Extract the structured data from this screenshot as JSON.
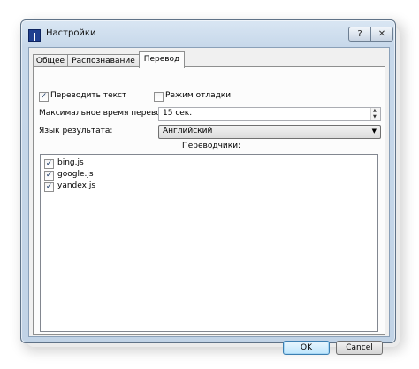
{
  "window": {
    "title": "Настройки",
    "help_label": "?",
    "close_label": "✕"
  },
  "tabs": [
    {
      "label": "Общее",
      "active": false
    },
    {
      "label": "Распознавание",
      "active": false
    },
    {
      "label": "Перевод",
      "active": true
    }
  ],
  "panel": {
    "translate_text": {
      "label": "Переводить текст",
      "checked": true
    },
    "debug_mode": {
      "label": "Режим отладки",
      "checked": false
    },
    "max_time": {
      "label": "Максимальное время перевода:",
      "value": "15 сек."
    },
    "result_lang": {
      "label": "Язык результата:",
      "value": "Английский"
    },
    "translators_heading": "Переводчики:",
    "translators": [
      {
        "label": "bing.js",
        "checked": true
      },
      {
        "label": "google.js",
        "checked": true
      },
      {
        "label": "yandex.js",
        "checked": true
      }
    ]
  },
  "buttons": {
    "ok": "OK",
    "cancel": "Cancel"
  },
  "icons": {
    "check": "✓",
    "spin_up": "▲",
    "spin_down": "▼",
    "combo_arrow": "▼"
  }
}
